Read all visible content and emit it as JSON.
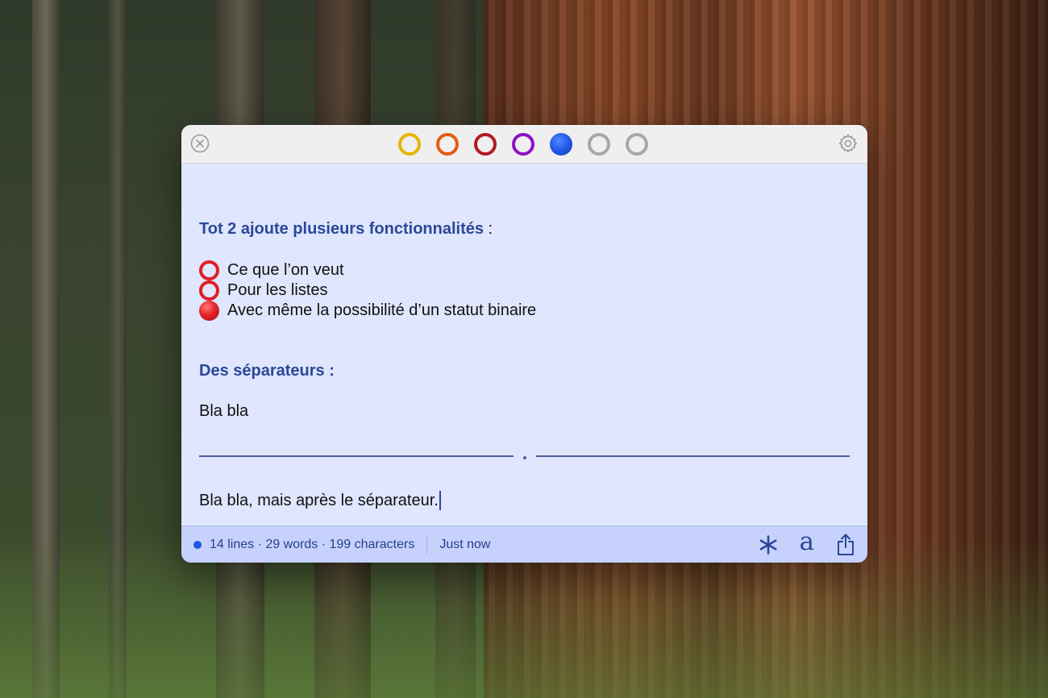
{
  "window": {
    "colors": [
      {
        "name": "yellow",
        "hex": "#e7b300",
        "selected": false
      },
      {
        "name": "orange",
        "hex": "#e55a10",
        "selected": false
      },
      {
        "name": "red",
        "hex": "#b01a20",
        "selected": false
      },
      {
        "name": "purple",
        "hex": "#8a12c8",
        "selected": false
      },
      {
        "name": "blue",
        "hex": "#1f55e6",
        "selected": true
      },
      {
        "name": "gray-1",
        "hex": "#a7a7a7",
        "selected": false
      },
      {
        "name": "gray-2",
        "hex": "#a7a7a7",
        "selected": false
      }
    ],
    "accent": "#2b4799",
    "background": "#dfe6fd"
  },
  "note": {
    "heading1": "Tot 2 ajoute plusieurs fonctionnalités",
    "heading1_suffix": " :",
    "items": [
      {
        "text": "Ce que l’on veut",
        "status": "open",
        "icon": "red-ring-icon"
      },
      {
        "text": "Pour les listes",
        "status": "open",
        "icon": "red-ring-icon"
      },
      {
        "text": "Avec même la possibilité d’un statut binaire",
        "status": "filled",
        "icon": "red-disc-icon"
      }
    ],
    "heading2": "Des séparateurs :",
    "text1": "Bla bla",
    "text2": "Bla bla, mais après le séparateur."
  },
  "footer": {
    "stats": "14 lines · 29 words · 199 characters",
    "saved": "Just now",
    "icons": [
      "asterisk-icon",
      "font-a-icon",
      "share-icon"
    ]
  }
}
